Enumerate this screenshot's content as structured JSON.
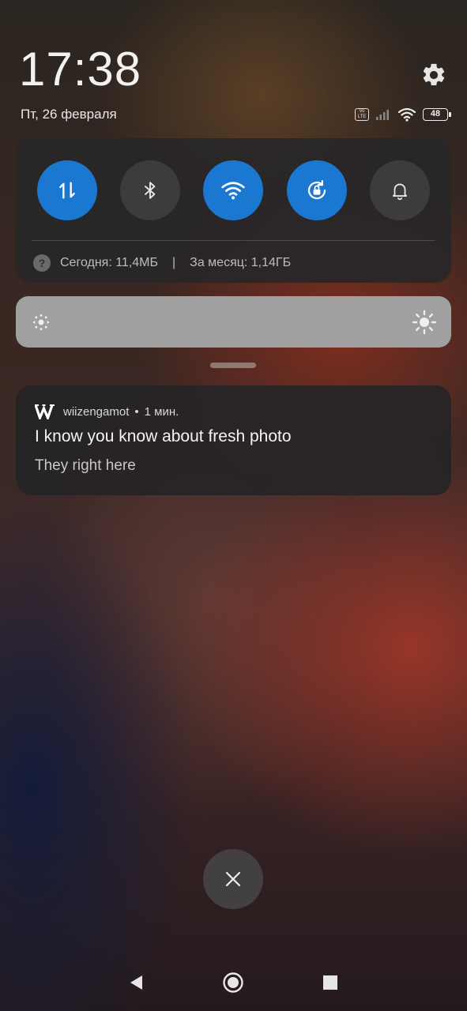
{
  "lockscreen": {
    "time": "17:38",
    "date": "Пт, 26 февраля"
  },
  "status_bar": {
    "volte_top": "Vo",
    "volte_bottom": "LTE",
    "battery_level": "48",
    "icons": [
      "volte-icon",
      "signal-icon",
      "wifi-icon",
      "battery-icon"
    ]
  },
  "quick_settings": {
    "toggles": [
      {
        "name": "mobile-data",
        "icon": "data-arrows-icon",
        "active": true
      },
      {
        "name": "bluetooth",
        "icon": "bluetooth-icon",
        "active": false
      },
      {
        "name": "wifi",
        "icon": "wifi-icon",
        "active": true
      },
      {
        "name": "auto-rotate-lock",
        "icon": "rotation-lock-icon",
        "active": true
      },
      {
        "name": "sound",
        "icon": "bell-icon",
        "active": false
      }
    ],
    "data_usage": {
      "today": "Сегодня: 11,4МБ",
      "separator": "|",
      "month": "За месяц: 1,14ГБ"
    },
    "accent_color": "#1b78d0"
  },
  "brightness": {
    "icons": [
      "brightness-low-icon",
      "brightness-high-icon"
    ]
  },
  "notification": {
    "app": "wiizengamot",
    "dot": "•",
    "time": "1 мин.",
    "title": "I know you know about fresh photo",
    "text": "They right here",
    "app_icon": "w-logo-icon"
  },
  "navigation": {
    "buttons": [
      "back-icon",
      "home-icon",
      "recents-icon"
    ]
  }
}
